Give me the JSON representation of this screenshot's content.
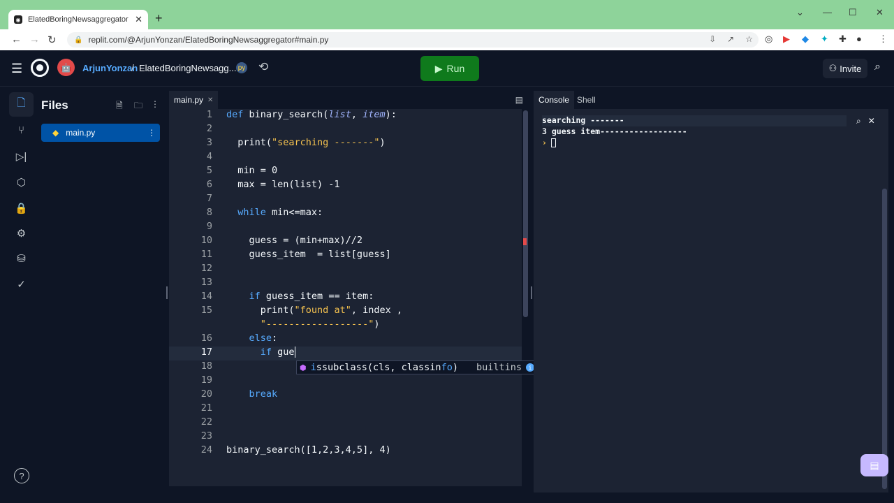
{
  "browser": {
    "tab_title": "ElatedBoringNewsaggregator - R",
    "url": "replit.com/@ArjunYonzan/ElatedBoringNewsaggregator#main.py"
  },
  "header": {
    "username": "ArjunYonzan",
    "separator": "/",
    "repl_name": "ElatedBoringNewsagg...",
    "run_label": "Run",
    "invite_label": "Invite"
  },
  "files": {
    "title": "Files",
    "items": [
      {
        "label": "main.py"
      }
    ]
  },
  "editor": {
    "tab_label": "main.py",
    "lines": [
      {
        "n": "1",
        "t": "def binary_search(list, item):"
      },
      {
        "n": "2",
        "t": ""
      },
      {
        "n": "3",
        "t": "  print(\"searching -------\")"
      },
      {
        "n": "4",
        "t": ""
      },
      {
        "n": "5",
        "t": "  min = 0"
      },
      {
        "n": "6",
        "t": "  max = len(list) -1"
      },
      {
        "n": "7",
        "t": ""
      },
      {
        "n": "8",
        "t": "  while min<=max:"
      },
      {
        "n": "9",
        "t": ""
      },
      {
        "n": "10",
        "t": "    guess = (min+max)//2"
      },
      {
        "n": "11",
        "t": "    guess_item  = list[guess]"
      },
      {
        "n": "12",
        "t": ""
      },
      {
        "n": "13",
        "t": ""
      },
      {
        "n": "14",
        "t": "    if guess_item == item:"
      },
      {
        "n": "15",
        "t": "      print(\"found at\", index ,"
      },
      {
        "n": "",
        "t": "      \"------------------\")"
      },
      {
        "n": "16",
        "t": "    else:"
      },
      {
        "n": "17",
        "t": "      if gue"
      },
      {
        "n": "18",
        "t": ""
      },
      {
        "n": "19",
        "t": ""
      },
      {
        "n": "20",
        "t": "    break"
      },
      {
        "n": "21",
        "t": ""
      },
      {
        "n": "22",
        "t": ""
      },
      {
        "n": "23",
        "t": ""
      },
      {
        "n": "24",
        "t": "binary_search([1,2,3,4,5], 4)"
      }
    ],
    "autocomplete": {
      "match": "i",
      "suggestion": "ssubclass(cls, classin",
      "match2": "fo",
      "suffix": ")",
      "module": "builtins"
    }
  },
  "console": {
    "tabs": [
      "Console",
      "Shell"
    ],
    "output": [
      "searching -------",
      "3 guess item------------------"
    ],
    "prompt": "›"
  },
  "colors": {
    "accent": "#57abff",
    "run": "#0f7a1c",
    "bg": "#0e1525",
    "panel": "#1c2333"
  }
}
